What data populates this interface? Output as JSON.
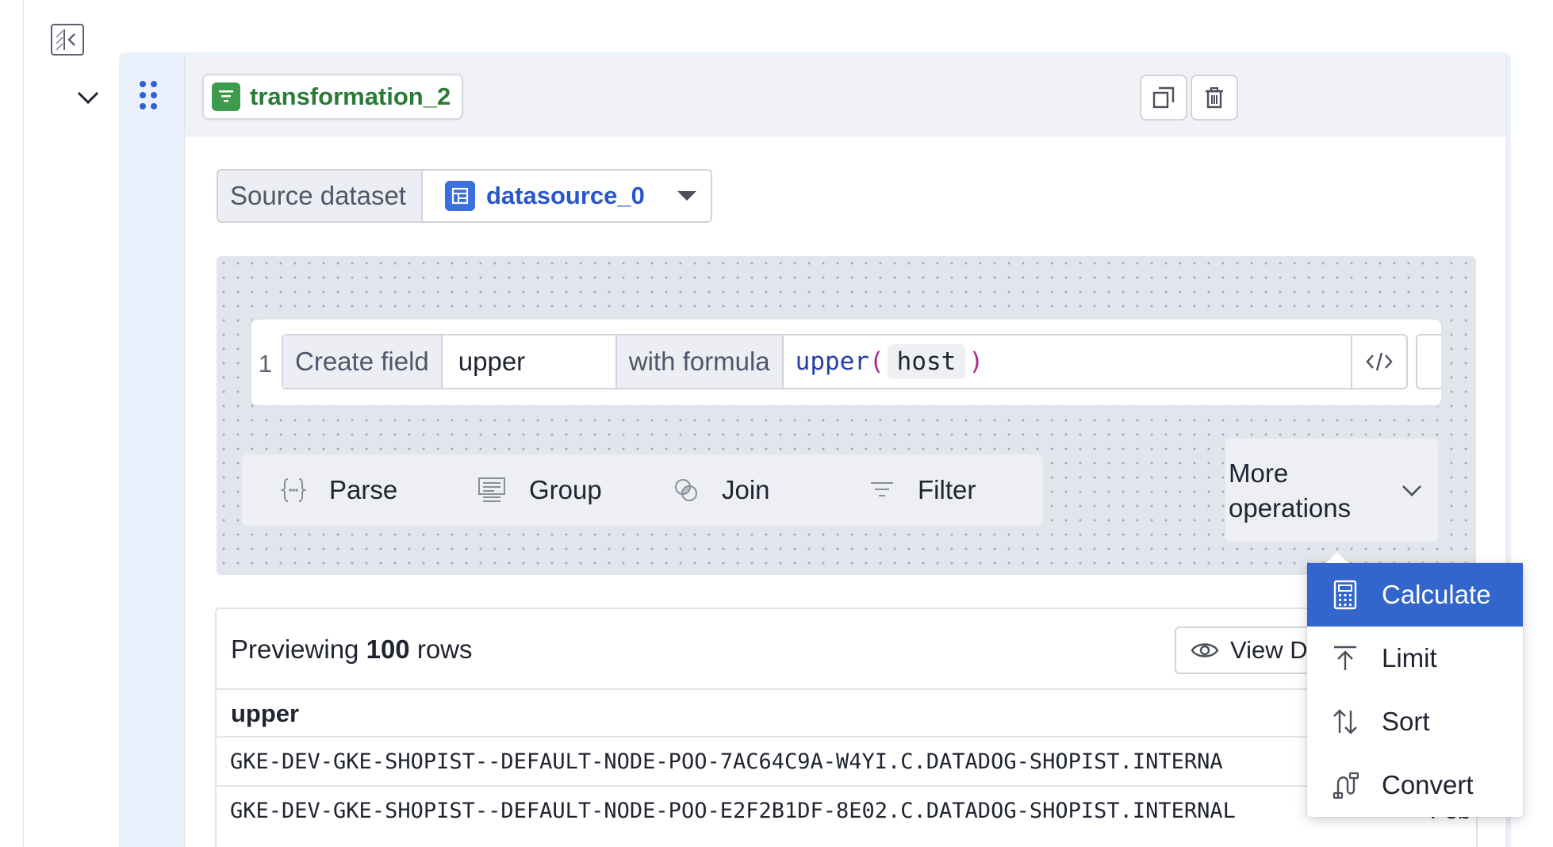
{
  "cell": {
    "name": "transformation_2"
  },
  "source": {
    "label": "Source dataset",
    "value": "datasource_0"
  },
  "step": {
    "number": "1",
    "create_label": "Create field",
    "field_name": "upper",
    "formula_label": "with formula",
    "formula_fn": "upper",
    "formula_open": "(",
    "formula_arg": "host",
    "formula_close": ")"
  },
  "operations": {
    "parse": "Parse",
    "group": "Group",
    "join": "Join",
    "filter": "Filter",
    "more": "More operations"
  },
  "preview": {
    "prefix": "Previewing",
    "count": "100",
    "suffix": "rows",
    "view_button": "View D",
    "column": "upper",
    "rows": [
      {
        "value": "GKE-DEV-GKE-SHOPIST--DEFAULT-NODE-POO-7AC64C9A-W4YI.C.DATADOG-SHOPIST.INTERNA",
        "extra": ""
      },
      {
        "value": "GKE-DEV-GKE-SHOPIST--DEFAULT-NODE-POO-E2F2B1DF-8E02.C.DATADOG-SHOPIST.INTERNAL",
        "extra": "Feb"
      }
    ]
  },
  "dropdown": {
    "items": [
      {
        "label": "Calculate",
        "icon": "calculator-icon",
        "active": true
      },
      {
        "label": "Limit",
        "icon": "limit-icon",
        "active": false
      },
      {
        "label": "Sort",
        "icon": "sort-icon",
        "active": false
      },
      {
        "label": "Convert",
        "icon": "convert-icon",
        "active": false
      }
    ]
  },
  "colors": {
    "accent": "#3366cc",
    "cell_badge": "#3c9b4c",
    "cell_name": "#2b7a36",
    "datasource": "#2857cc",
    "formula_fn": "#243fa7",
    "formula_paren": "#b0248d"
  }
}
